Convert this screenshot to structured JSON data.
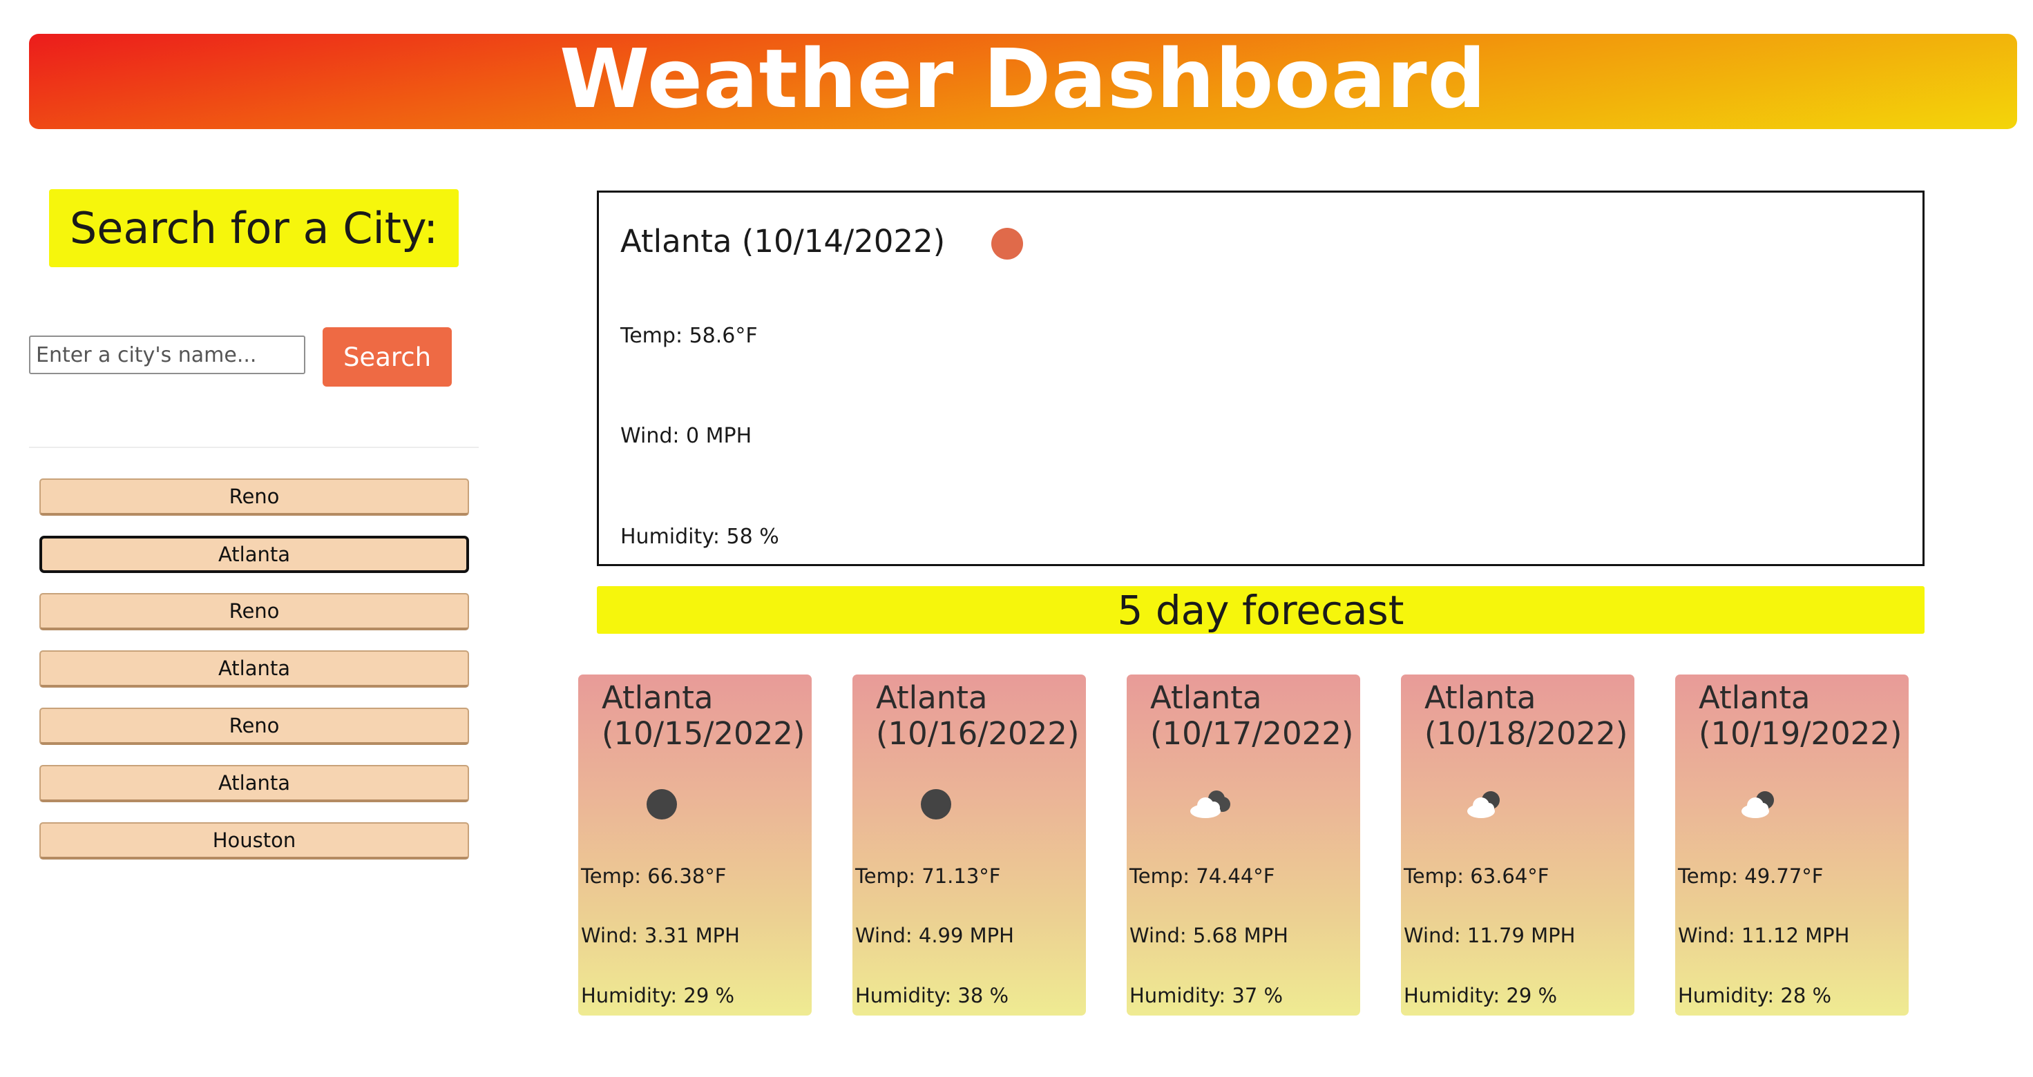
{
  "header": {
    "title": "Weather Dashboard"
  },
  "sidebar": {
    "search_title": "Search for a City:",
    "search_placeholder": "Enter a city's name...",
    "search_button": "Search",
    "history": [
      {
        "label": "Reno"
      },
      {
        "label": "Atlanta",
        "active": true
      },
      {
        "label": "Reno"
      },
      {
        "label": "Atlanta"
      },
      {
        "label": "Reno"
      },
      {
        "label": "Atlanta"
      },
      {
        "label": "Houston"
      }
    ]
  },
  "current": {
    "title": "Atlanta (10/14/2022)",
    "icon": "sun-icon",
    "temp": "Temp: 58.6°F",
    "wind": "Wind: 0 MPH",
    "humidity": "Humidity: 58 %"
  },
  "forecast": {
    "title": "5 day forecast",
    "days": [
      {
        "city": "Atlanta",
        "date": "(10/15/2022)",
        "icon": "clear-night-icon",
        "temp": "Temp: 66.38°F",
        "wind": "Wind: 3.31 MPH",
        "humidity": "Humidity: 29 %"
      },
      {
        "city": "Atlanta",
        "date": "(10/16/2022)",
        "icon": "clear-night-icon",
        "temp": "Temp: 71.13°F",
        "wind": "Wind: 4.99 MPH",
        "humidity": "Humidity: 38 %"
      },
      {
        "city": "Atlanta",
        "date": "(10/17/2022)",
        "icon": "broken-clouds-icon",
        "temp": "Temp: 74.44°F",
        "wind": "Wind: 5.68 MPH",
        "humidity": "Humidity: 37 %"
      },
      {
        "city": "Atlanta",
        "date": "(10/18/2022)",
        "icon": "partly-cloudy-night-icon",
        "temp": "Temp: 63.64°F",
        "wind": "Wind: 11.79 MPH",
        "humidity": "Humidity: 29 %"
      },
      {
        "city": "Atlanta",
        "date": "(10/19/2022)",
        "icon": "partly-cloudy-night-icon",
        "temp": "Temp: 49.77°F",
        "wind": "Wind: 11.12 MPH",
        "humidity": "Humidity: 28 %"
      }
    ]
  },
  "colors": {
    "header_gradient": [
      "#ec1c1c",
      "#f3d50a"
    ],
    "highlight_yellow": "#f6f60c",
    "search_button": "#ee6a44",
    "history_button": "#f6d4b1",
    "sun": "#e06a4a"
  }
}
